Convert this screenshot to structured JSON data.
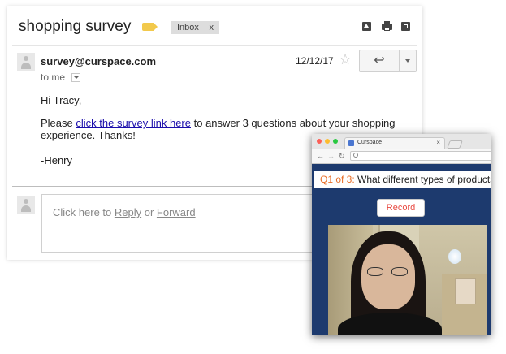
{
  "email": {
    "subject": "shopping survey",
    "inbox_chip": {
      "label": "Inbox",
      "close": "x"
    },
    "icons": [
      "archive-up-icon",
      "print-icon",
      "popout-icon"
    ],
    "sender": "survey@curspace.com",
    "date": "12/12/17",
    "recipient": "to me",
    "greeting": "Hi Tracy,",
    "body_before_link": "Please ",
    "link_text": "click the survey link here",
    "body_after_link": " to answer 3 questions about your shopping experience. Thanks!",
    "signoff": "-Henry",
    "reply_box": {
      "prefix": "Click here to ",
      "reply": "Reply",
      "or": " or ",
      "forward": "Forward"
    }
  },
  "browser": {
    "tab_title": "Curspace",
    "tab_close": "×",
    "question_number": "Q1 of 3:",
    "question_text": " What different types of products",
    "record_label": "Record"
  },
  "colors": {
    "label_tag": "#f2c94c",
    "link": "#1a0dab",
    "question_number": "#e8702a",
    "record": "#e8473f",
    "page_background": "#1d3a6e"
  }
}
